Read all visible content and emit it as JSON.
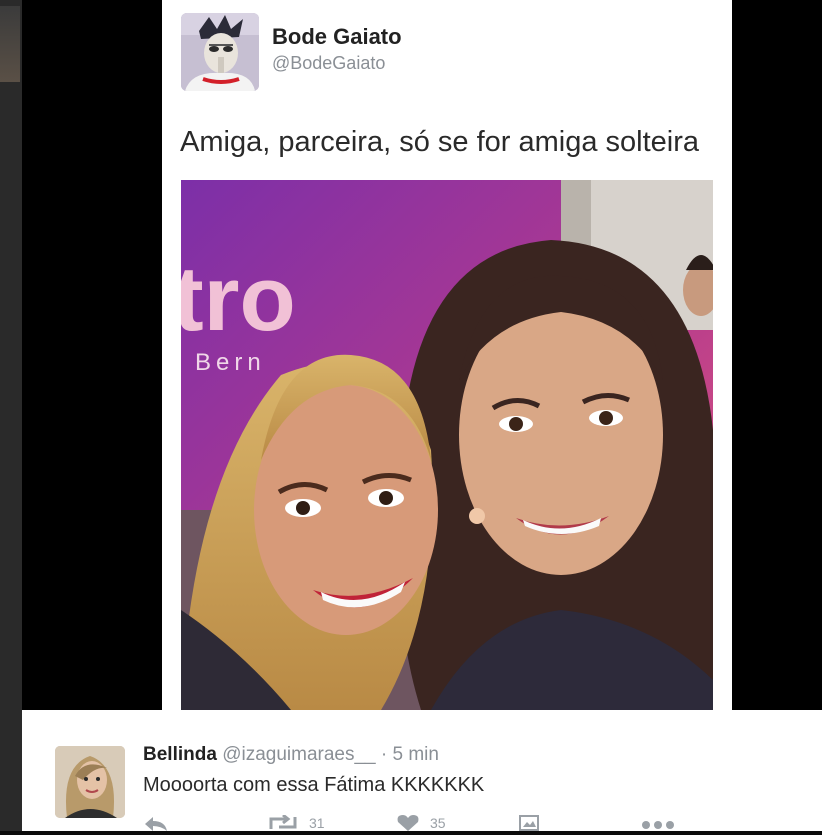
{
  "tweet": {
    "author_name": "Bode Gaiato",
    "author_handle": "@BodeGaiato",
    "text": "Amiga, parceira, só se for amiga solteira",
    "photo_sign_text": "tro",
    "photo_sub_text": "Bern"
  },
  "reply": {
    "name": "Bellinda",
    "handle": "@izaguimaraes__",
    "separator": "·",
    "time": "5 min",
    "text": "Moooorta com essa Fátima KKKKKKK",
    "actions": {
      "reply_icon": "reply-icon",
      "retweet_icon": "retweet-icon",
      "retweet_count": "31",
      "like_icon": "heart-icon",
      "like_count": "35",
      "media_icon": "media-icon",
      "more_icon": "more-icon"
    }
  },
  "colors": {
    "page_background": "#000000",
    "card_background": "#ffffff",
    "secondary_text": "#8a8f95",
    "sign_purple": "#a0288c",
    "sign_pink": "#e64a74"
  }
}
